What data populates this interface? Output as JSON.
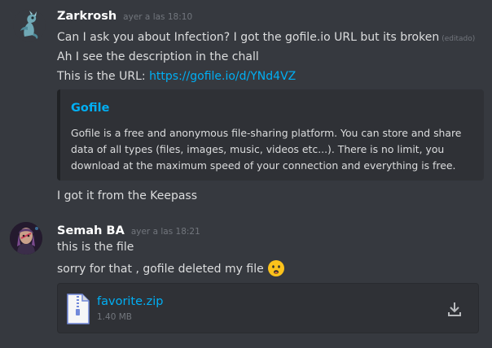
{
  "messages": [
    {
      "username": "Zarkrosh",
      "timestamp": "ayer a las 18:10",
      "lines": [
        "Can I ask you about Infection? I got the gofile.io URL but its broken",
        "Ah I see the description in the chall",
        "This is the URL: ",
        "I got it from the Keepass"
      ],
      "edited_label": "(editado)",
      "url": "https://gofile.io/d/YNd4VZ",
      "embed": {
        "title": "Gofile",
        "description": "Gofile is a free and anonymous file-sharing platform. You can store and share data of all types (files, images, music, videos etc...). There is no limit, you download at the maximum speed of your connection and everything is free."
      }
    },
    {
      "username": "Semah BA",
      "timestamp": "ayer a las 18:21",
      "lines": [
        "this is the file",
        "sorry for that , gofile deleted my file"
      ],
      "emoji": "frowning-face",
      "attachment": {
        "file_name": "favorite.zip",
        "file_size": "1.40 MB"
      }
    }
  ],
  "colors": {
    "background": "#36393f",
    "link": "#00aff4",
    "embed_bg": "#2f3136",
    "username": "#ffffff",
    "timestamp": "#72767d"
  }
}
